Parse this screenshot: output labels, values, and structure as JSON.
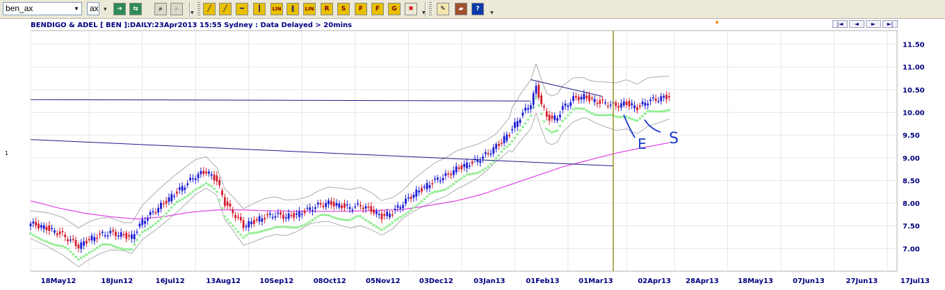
{
  "toolbar": {
    "symbol_value": "ben_ax",
    "exchange_value": "ax",
    "buttons": [
      {
        "name": "go-arrow-icon",
        "label": "➔",
        "bg": "#2e8b57",
        "fg": "#ffffff"
      },
      {
        "name": "refresh-icon",
        "label": "⇆",
        "bg": "#2e8b57",
        "fg": "#ffffff"
      },
      {
        "name": "binoculars-icon",
        "label": "⌕",
        "bg": "#dcd8c8",
        "fg": "#000000"
      },
      {
        "name": "binoculars-disabled-icon",
        "label": "⌕",
        "bg": "#dcd8c8",
        "fg": "#9a9a9a"
      },
      {
        "name": "draw-line-icon",
        "label": "╱",
        "bg": "#e8c000",
        "fg": "#000080"
      },
      {
        "name": "trend-line-icon",
        "label": "╱",
        "bg": "#e8c000",
        "fg": "#000080"
      },
      {
        "name": "horizontal-line-icon",
        "label": "━",
        "bg": "#e8c000",
        "fg": "#000080"
      },
      {
        "name": "vertical-line-icon",
        "label": "┃",
        "bg": "#e8c000",
        "fg": "#000080"
      },
      {
        "name": "lin-icon",
        "label": "LIN",
        "bg": "#e8c000",
        "fg": "#800000"
      },
      {
        "name": "parallel-lines-icon",
        "label": "∥",
        "bg": "#e8c000",
        "fg": "#000080"
      },
      {
        "name": "lin-channel-icon",
        "label": "LIN",
        "bg": "#e8c000",
        "fg": "#800000"
      },
      {
        "name": "retracement-icon",
        "label": "R",
        "bg": "#e8c000",
        "fg": "#800000"
      },
      {
        "name": "speed-lines-icon",
        "label": "S",
        "bg": "#e8c000",
        "fg": "#800000"
      },
      {
        "name": "fibonacci-icon",
        "label": "F",
        "bg": "#e8c000",
        "fg": "#800000"
      },
      {
        "name": "fibonacci-ext-icon",
        "label": "F",
        "bg": "#e8c000",
        "fg": "#800000"
      },
      {
        "name": "gann-icon",
        "label": "G",
        "bg": "#e8c000",
        "fg": "#800000"
      },
      {
        "name": "delete-drawing-icon",
        "label": "✖",
        "bg": "#ece9d8",
        "fg": "#d00000"
      },
      {
        "name": "notes-icon",
        "label": "✎",
        "bg": "#f2e8b0",
        "fg": "#000000"
      },
      {
        "name": "book-icon",
        "label": "▰",
        "bg": "#a0522d",
        "fg": "#ffffff"
      },
      {
        "name": "help-icon",
        "label": "?",
        "bg": "#0a3aa8",
        "fg": "#ffffff"
      }
    ]
  },
  "chart_title": "BENDIGO & ADEL [ BEN ]:DAILY:23Apr2013 15:55 Sydney : Data Delayed > 20mins",
  "pane_label": "1",
  "nav": [
    "|◄",
    "◄",
    "►",
    "►|"
  ],
  "chart_data": {
    "type": "candlestick",
    "ylim": [
      6.5,
      11.8
    ],
    "y_ticks": [
      "11.50",
      "11.00",
      "10.50",
      "10.00",
      "9.50",
      "9.00",
      "8.50",
      "8.00",
      "7.50",
      "7.00"
    ],
    "y_tick_values": [
      11.5,
      11.0,
      10.5,
      10.0,
      9.5,
      9.0,
      8.5,
      8.0,
      7.5,
      7.0
    ],
    "x_ticks": [
      "18May12",
      "18Jun12",
      "16Jul12",
      "13Aug12",
      "10Sep12",
      "08Oct12",
      "05Nov12",
      "03Dec12",
      "03Jan13",
      "01Feb13",
      "01Mar13",
      "02Apr13",
      "28Apr13",
      "18May13",
      "07Jun13",
      "27Jun13",
      "17Jul13"
    ],
    "x_tick_day_index": [
      0,
      22,
      42,
      62,
      82,
      102,
      122,
      142,
      162,
      182,
      202,
      224,
      242,
      262,
      282,
      302,
      322
    ],
    "last_bar_day_index": 240,
    "price_anchors": [
      [
        0,
        7.55
      ],
      [
        6,
        7.45
      ],
      [
        12,
        7.3
      ],
      [
        18,
        7.05
      ],
      [
        22,
        7.2
      ],
      [
        26,
        7.3
      ],
      [
        30,
        7.35
      ],
      [
        34,
        7.3
      ],
      [
        38,
        7.25
      ],
      [
        42,
        7.6
      ],
      [
        46,
        7.8
      ],
      [
        50,
        8.0
      ],
      [
        54,
        8.2
      ],
      [
        58,
        8.4
      ],
      [
        62,
        8.6
      ],
      [
        66,
        8.7
      ],
      [
        70,
        8.5
      ],
      [
        73,
        8.0
      ],
      [
        76,
        7.8
      ],
      [
        80,
        7.5
      ],
      [
        84,
        7.6
      ],
      [
        88,
        7.7
      ],
      [
        92,
        7.75
      ],
      [
        96,
        7.7
      ],
      [
        100,
        7.75
      ],
      [
        104,
        7.85
      ],
      [
        108,
        7.95
      ],
      [
        112,
        8.0
      ],
      [
        116,
        7.95
      ],
      [
        120,
        7.9
      ],
      [
        124,
        7.95
      ],
      [
        128,
        7.85
      ],
      [
        132,
        7.7
      ],
      [
        136,
        7.8
      ],
      [
        140,
        8.0
      ],
      [
        144,
        8.2
      ],
      [
        148,
        8.35
      ],
      [
        152,
        8.5
      ],
      [
        156,
        8.6
      ],
      [
        160,
        8.75
      ],
      [
        164,
        8.85
      ],
      [
        168,
        8.95
      ],
      [
        172,
        9.1
      ],
      [
        176,
        9.3
      ],
      [
        180,
        9.55
      ],
      [
        184,
        9.9
      ],
      [
        188,
        10.2
      ],
      [
        190,
        10.55
      ],
      [
        192,
        10.2
      ],
      [
        194,
        9.9
      ],
      [
        196,
        9.85
      ],
      [
        198,
        9.9
      ],
      [
        200,
        10.1
      ],
      [
        204,
        10.3
      ],
      [
        208,
        10.35
      ],
      [
        212,
        10.25
      ],
      [
        216,
        10.2
      ],
      [
        220,
        10.15
      ],
      [
        224,
        10.2
      ],
      [
        228,
        10.1
      ],
      [
        232,
        10.25
      ],
      [
        236,
        10.3
      ],
      [
        240,
        10.35
      ]
    ],
    "ma_anchors": [
      [
        0,
        8.05
      ],
      [
        10,
        7.9
      ],
      [
        20,
        7.78
      ],
      [
        30,
        7.7
      ],
      [
        40,
        7.65
      ],
      [
        50,
        7.7
      ],
      [
        60,
        7.8
      ],
      [
        70,
        7.85
      ],
      [
        80,
        7.85
      ],
      [
        90,
        7.83
      ],
      [
        100,
        7.82
      ],
      [
        110,
        7.82
      ],
      [
        120,
        7.82
      ],
      [
        130,
        7.84
      ],
      [
        140,
        7.86
      ],
      [
        150,
        7.95
      ],
      [
        160,
        8.05
      ],
      [
        170,
        8.2
      ],
      [
        180,
        8.4
      ],
      [
        190,
        8.6
      ],
      [
        200,
        8.8
      ],
      [
        210,
        8.95
      ],
      [
        220,
        9.1
      ],
      [
        230,
        9.22
      ],
      [
        240,
        9.33
      ]
    ],
    "drawn_lines": [
      {
        "name": "resistance-line-upper",
        "from": [
          0,
          10.28
        ],
        "to": [
          188,
          10.25
        ],
        "color": "#1a1a8a"
      },
      {
        "name": "trend-line-lower",
        "from": [
          0,
          9.4
        ],
        "to": [
          219,
          8.82
        ],
        "color": "#1a1a8a"
      },
      {
        "name": "trend-line-top",
        "from": [
          188,
          10.72
        ],
        "to": [
          215,
          10.35
        ],
        "color": "#1a1a8a"
      }
    ],
    "vertical_marker_day_index": 219,
    "annotations": [
      "E",
      "S"
    ],
    "colors": {
      "up": "#1c1cd4",
      "down": "#d41c2c",
      "ma": "#e040e0",
      "envelope": "#999999",
      "stop": "#90ee90",
      "marker": "#8b8000",
      "grid": "#e6e6e6"
    }
  }
}
